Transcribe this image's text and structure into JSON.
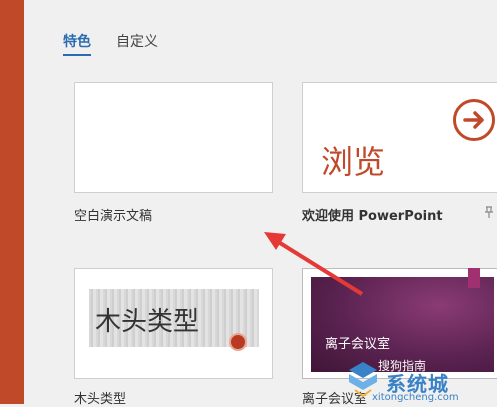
{
  "tabs": {
    "featured": "特色",
    "custom": "自定义"
  },
  "templates": [
    {
      "label": "空白演示文稿"
    },
    {
      "label": "欢迎使用 PowerPoint",
      "thumb_text": "浏览"
    },
    {
      "label": "木头类型",
      "thumb_text": "木头类型"
    },
    {
      "label": "离子会议室",
      "thumb_text": "离子会议室"
    }
  ],
  "watermark": {
    "text": "搜狗指南",
    "site": "系统城",
    "url": "xitongcheng.com"
  },
  "colors": {
    "accent": "#c0492a",
    "tab_active": "#2b6cb0",
    "ion": "#5b2351"
  }
}
